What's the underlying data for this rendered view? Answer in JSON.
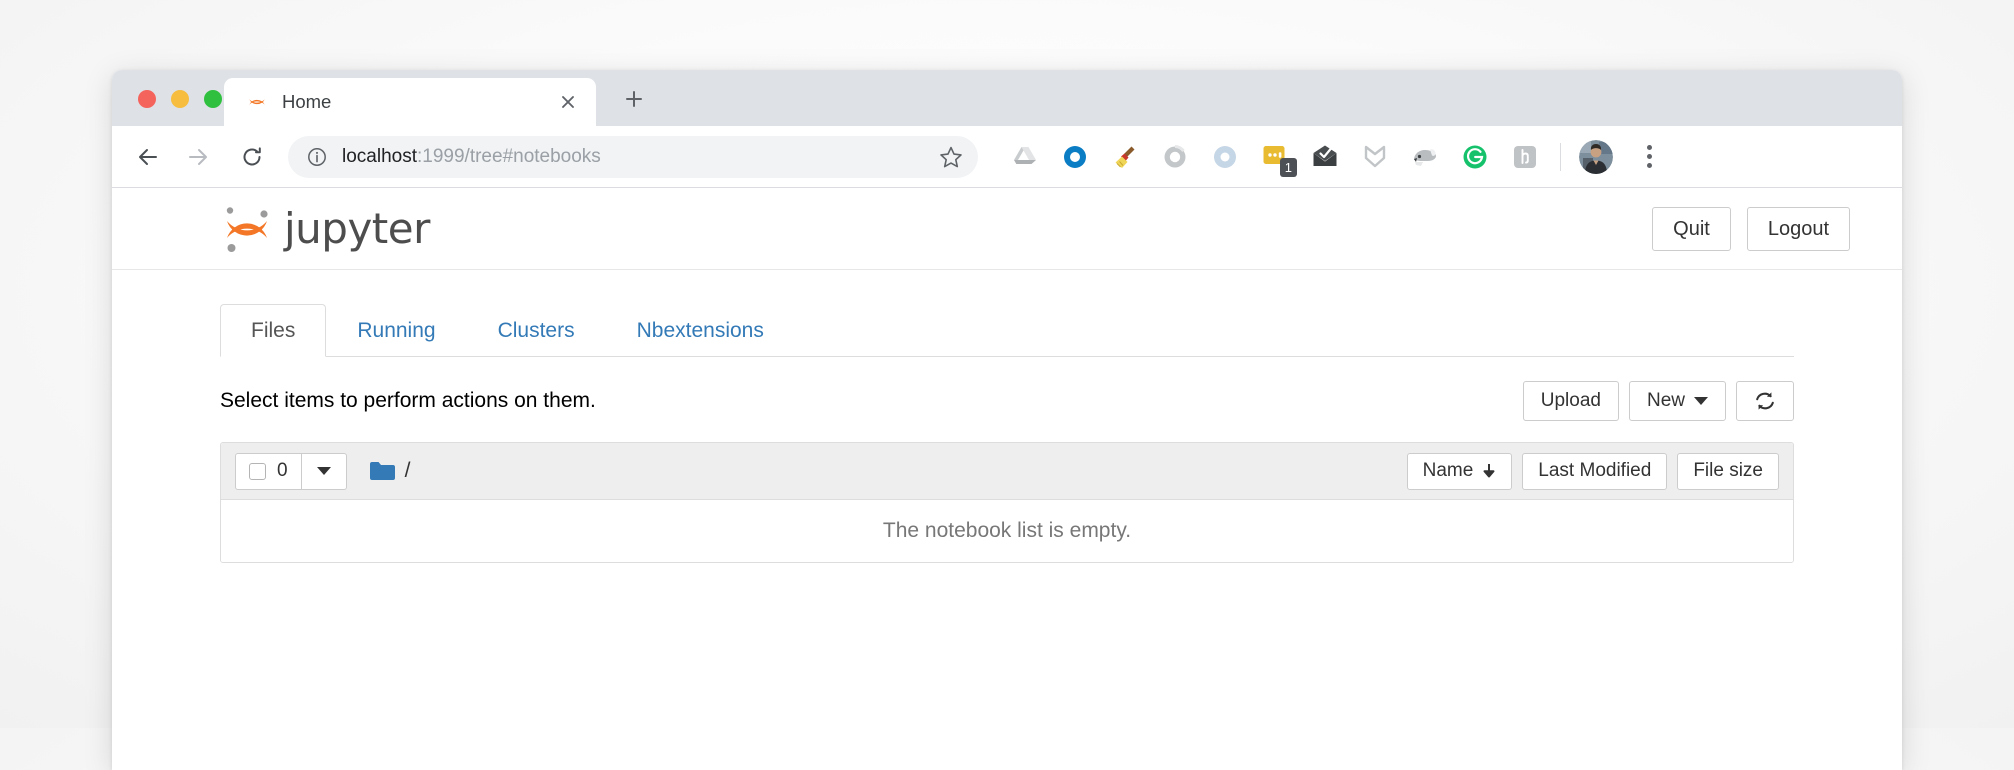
{
  "browser": {
    "traffic_lights": [
      "close",
      "minimize",
      "maximize"
    ],
    "tab": {
      "title": "Home",
      "favicon": "jupyter-favicon",
      "close_label": "×"
    },
    "new_tab_label": "+",
    "nav": {
      "back": "back-arrow",
      "forward": "forward-arrow",
      "reload": "reload-arrow"
    },
    "omnibox": {
      "info_icon": "info-circle-icon",
      "host": "localhost",
      "path": ":1999/tree#notebooks",
      "star_icon": "bookmark-star-icon"
    },
    "extensions": [
      {
        "name": "google-drive-icon",
        "label": "Google Drive"
      },
      {
        "name": "blue-ring-icon",
        "label": "Blue Ring Extension"
      },
      {
        "name": "broom-icon",
        "label": "Broom Cleaner"
      },
      {
        "name": "gray-ring-icon",
        "label": "Gray Ring Extension"
      },
      {
        "name": "blue-swirl-icon",
        "label": "Blue Swirl Extension"
      },
      {
        "name": "yellow-note-icon",
        "label": "Notes",
        "badge": "1"
      },
      {
        "name": "envelope-check-icon",
        "label": "Mail Checker"
      },
      {
        "name": "gray-chevron-icon",
        "label": "Chevron Extension"
      },
      {
        "name": "dog-icon",
        "label": "Dog Extension"
      },
      {
        "name": "grammarly-icon",
        "label": "Grammarly"
      },
      {
        "name": "hypothesis-icon",
        "label": "Hypothesis"
      }
    ],
    "profile_avatar": "user-avatar",
    "menu_label": "chrome-menu"
  },
  "jupyter": {
    "logo_text": "jupyter",
    "header_buttons": [
      {
        "name": "quit-button",
        "label": "Quit"
      },
      {
        "name": "logout-button",
        "label": "Logout"
      }
    ],
    "tabs": [
      {
        "name": "tab-files",
        "label": "Files",
        "active": true
      },
      {
        "name": "tab-running",
        "label": "Running",
        "active": false
      },
      {
        "name": "tab-clusters",
        "label": "Clusters",
        "active": false
      },
      {
        "name": "tab-nbextensions",
        "label": "Nbextensions",
        "active": false
      }
    ],
    "action_bar": {
      "hint": "Select items to perform actions on them.",
      "upload_label": "Upload",
      "new_label": "New",
      "refresh_icon": "refresh-icon"
    },
    "file_list": {
      "selected_count": "0",
      "breadcrumb_path": "/",
      "folder_icon": "folder-icon",
      "columns": [
        {
          "name": "sort-name",
          "label": "Name",
          "sort_indicator": "↓"
        },
        {
          "name": "sort-last-modified",
          "label": "Last Modified",
          "sort_indicator": ""
        },
        {
          "name": "sort-file-size",
          "label": "File size",
          "sort_indicator": ""
        }
      ],
      "empty_message": "The notebook list is empty.",
      "rows": []
    }
  },
  "colors": {
    "jupyter_orange": "#f37726",
    "link_blue": "#337ab7",
    "folder_blue": "#337ab7",
    "tabstrip_gray": "#dee1e6"
  }
}
